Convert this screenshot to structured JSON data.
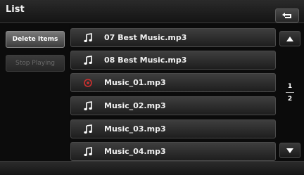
{
  "header": {
    "title": "List"
  },
  "side": {
    "delete_label": "Delete Items",
    "stop_label": "Stop Playing"
  },
  "list": {
    "items": [
      {
        "name": "07 Best Music.mp3",
        "icon": "note-icon",
        "playing": false
      },
      {
        "name": "08 Best Music.mp3",
        "icon": "note-icon",
        "playing": false
      },
      {
        "name": "Music_01.mp3",
        "icon": "playing-disc-icon",
        "playing": true
      },
      {
        "name": "Music_02.mp3",
        "icon": "note-icon",
        "playing": false
      },
      {
        "name": "Music_03.mp3",
        "icon": "note-icon",
        "playing": false
      },
      {
        "name": "Music_04.mp3",
        "icon": "note-icon",
        "playing": false
      }
    ]
  },
  "pager": {
    "current": "1",
    "total": "2"
  },
  "colors": {
    "accent_playing": "#d0302f",
    "text": "#ffffff"
  }
}
